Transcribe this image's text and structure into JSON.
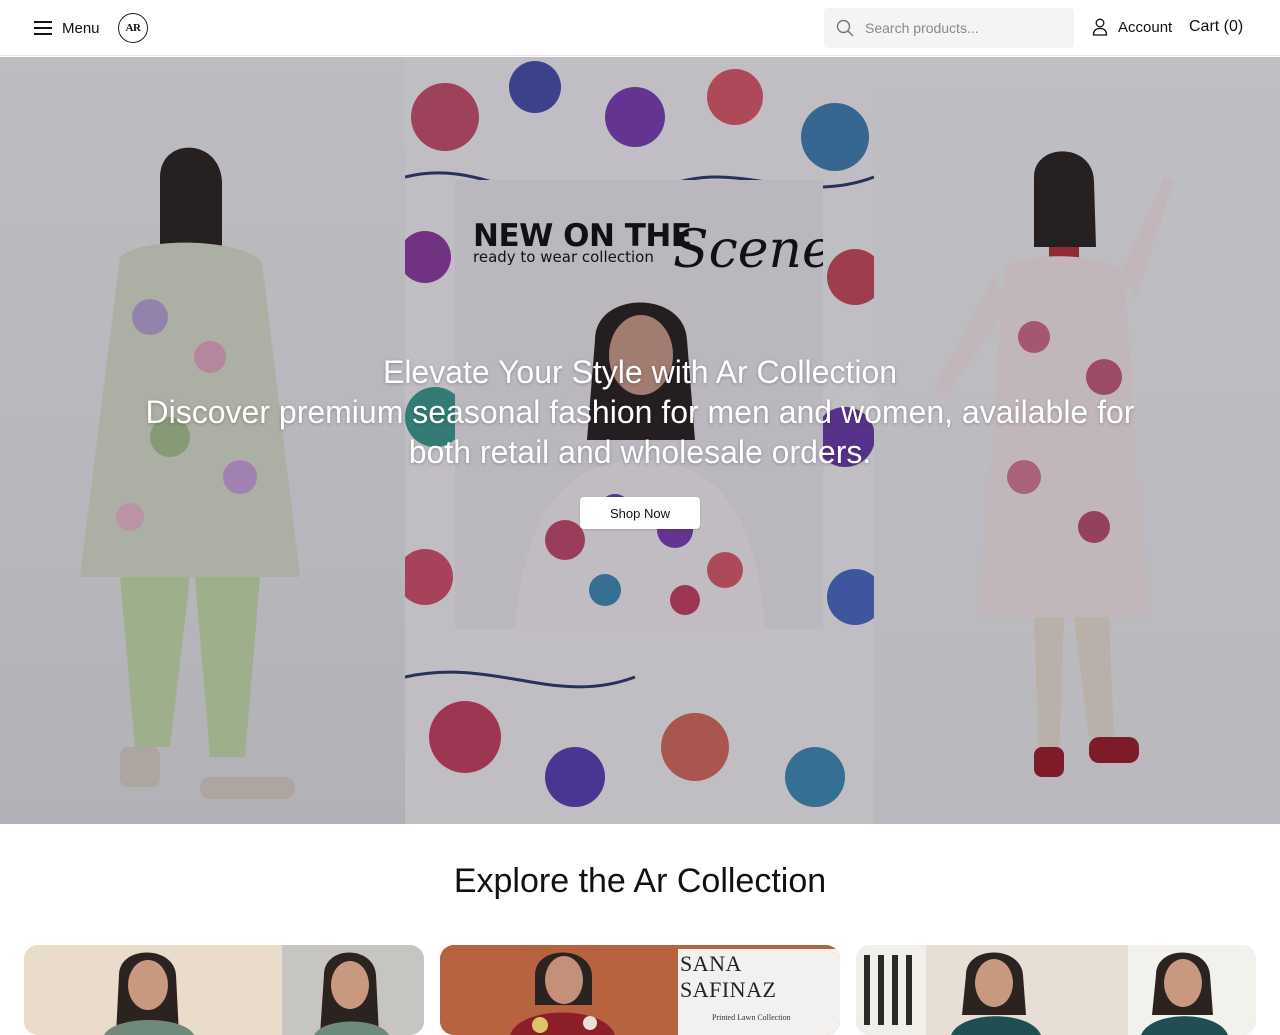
{
  "header": {
    "menu_label": "Menu",
    "logo_text": "AR",
    "search_placeholder": "Search products...",
    "account_label": "Account",
    "cart_label": "Cart (0)"
  },
  "hero": {
    "title": "Elevate Your Style with Ar Collection",
    "subtitle": "Discover premium seasonal fashion for men and women, available for both retail and wholesale orders.",
    "cta_label": "Shop Now",
    "promo": {
      "headline": "NEW ON THE",
      "script": "Scene",
      "tagline": "ready to wear collection"
    }
  },
  "explore": {
    "title": "Explore the Ar Collection",
    "cards": [
      {
        "brand": ""
      },
      {
        "brand": "SANA SAFINAZ",
        "brand_sub": "Printed Lawn Collection"
      },
      {
        "brand": ""
      }
    ]
  },
  "colors": {
    "accent": "#111111",
    "search_bg": "#f4f4f4",
    "hero_overlay": "#14142338"
  }
}
